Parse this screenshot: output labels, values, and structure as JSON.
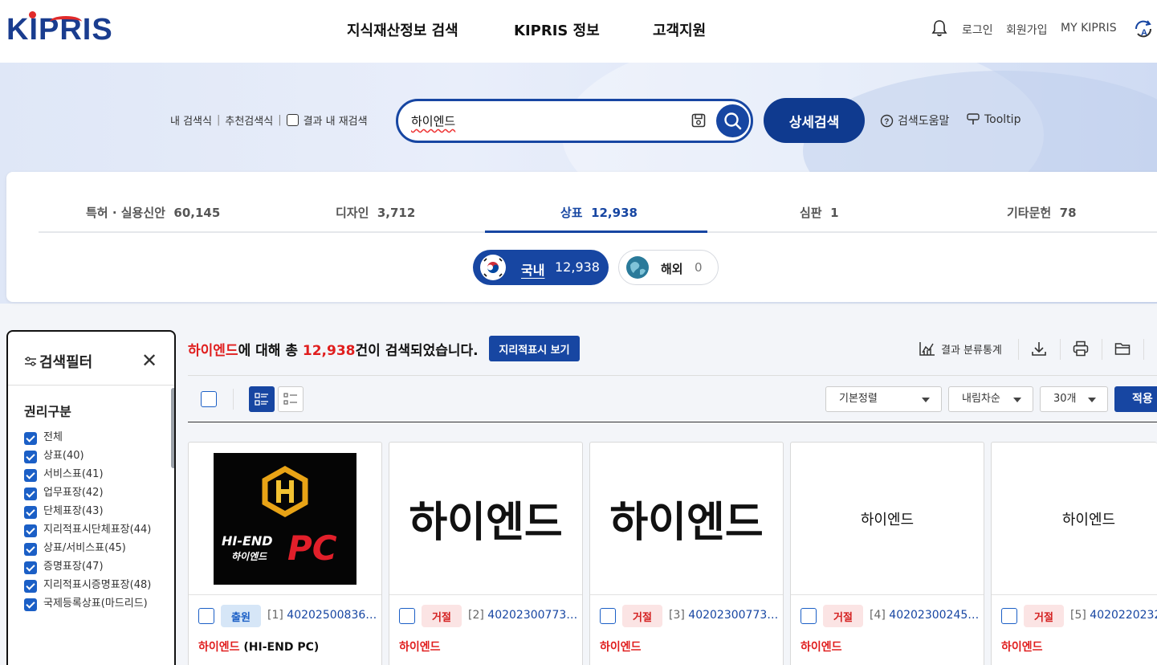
{
  "header": {
    "logo": "KIPRIS",
    "nav": [
      "지식재산정보 검색",
      "KIPRIS 정보",
      "고객지원"
    ],
    "links": [
      "로그인",
      "회원가입",
      "MY KIPRIS"
    ]
  },
  "search": {
    "my_search": "내 검색식",
    "recommend": "추천검색식",
    "in_result": "결과 내 재검색",
    "query": "하이엔드",
    "detail_button": "상세검색",
    "help": "검색도움말",
    "tooltip": "Tooltip"
  },
  "tabs": [
    {
      "label": "특허 · 실용신안",
      "count": "60,145"
    },
    {
      "label": "디자인",
      "count": "3,712"
    },
    {
      "label": "상표",
      "count": "12,938"
    },
    {
      "label": "심판",
      "count": "1"
    },
    {
      "label": "기타문헌",
      "count": "78"
    }
  ],
  "region": {
    "domestic_label": "국내",
    "domestic_count": "12,938",
    "overseas_label": "해외",
    "overseas_count": "0"
  },
  "filter": {
    "title": "검색필터",
    "section": "권리구분",
    "items": [
      "전체",
      "상표(40)",
      "서비스표(41)",
      "업무표장(42)",
      "단체표장(43)",
      "지리적표시단체표장(44)",
      "상표/서비스표(45)",
      "증명표장(47)",
      "지리적표시증명표장(48)",
      "국제등록상표(마드리드)"
    ]
  },
  "result": {
    "keyword": "하이엔드",
    "text_mid": "에 대해 총 ",
    "total": "12,938",
    "text_end": "건이 검색되었습니다.",
    "geo_button": "지리적표시 보기",
    "stats": "결과 분류통계",
    "sort": "기본정렬",
    "order": "내림차순",
    "per_page": "30개",
    "apply": "적용"
  },
  "cards": [
    {
      "status": "출원",
      "idx": "[1]",
      "number": "40202500836…",
      "name_hl": "하이엔드",
      "name_rest": " (HI-END PC)",
      "image_text": "HI-END PC 하이엔드"
    },
    {
      "status": "거절",
      "idx": "[2]",
      "number": "40202300773…",
      "name_hl": "하이엔드",
      "name_rest": "",
      "image_text": "하이엔드"
    },
    {
      "status": "거절",
      "idx": "[3]",
      "number": "40202300773…",
      "name_hl": "하이엔드",
      "name_rest": "",
      "image_text": "하이엔드"
    },
    {
      "status": "거절",
      "idx": "[4]",
      "number": "40202300245…",
      "name_hl": "하이엔드",
      "name_rest": "",
      "image_text": "하이엔드"
    },
    {
      "status": "거절",
      "idx": "[5]",
      "number": "4020220232",
      "name_hl": "하이엔드",
      "name_rest": "",
      "image_text": "하이엔드"
    }
  ],
  "colors": {
    "primary": "#1746a2",
    "highlight": "#e01e1e",
    "reject": "#d42020"
  }
}
